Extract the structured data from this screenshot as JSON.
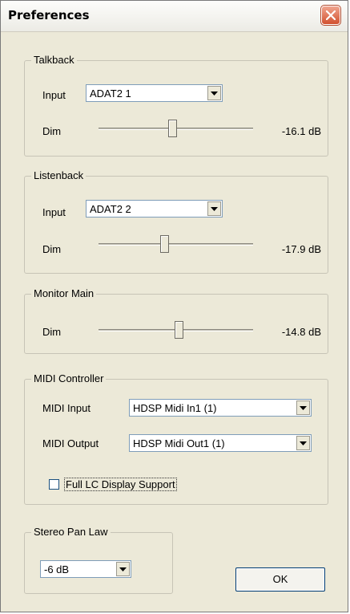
{
  "window": {
    "title": "Preferences"
  },
  "talkback": {
    "group_label": "Talkback",
    "input_label": "Input",
    "input_value": "ADAT2 1",
    "dim_label": "Dim",
    "dim_value": "-16.1 dB",
    "dim_level": 0.48
  },
  "listenback": {
    "group_label": "Listenback",
    "input_label": "Input",
    "input_value": "ADAT2 2",
    "dim_label": "Dim",
    "dim_value": "-17.9 dB",
    "dim_level": 0.43
  },
  "monitor_main": {
    "group_label": "Monitor Main",
    "dim_label": "Dim",
    "dim_value": "-14.8 dB",
    "dim_level": 0.52
  },
  "midi_controller": {
    "group_label": "MIDI Controller",
    "input_label": "MIDI Input",
    "input_value": "HDSP Midi In1 (1)",
    "output_label": "MIDI Output",
    "output_value": "HDSP Midi Out1 (1)",
    "lcd_label": "Full LC Display Support",
    "lcd_checked": false
  },
  "stereo_pan_law": {
    "group_label": "Stereo Pan Law",
    "value": "-6 dB"
  },
  "buttons": {
    "ok_label": "OK"
  }
}
